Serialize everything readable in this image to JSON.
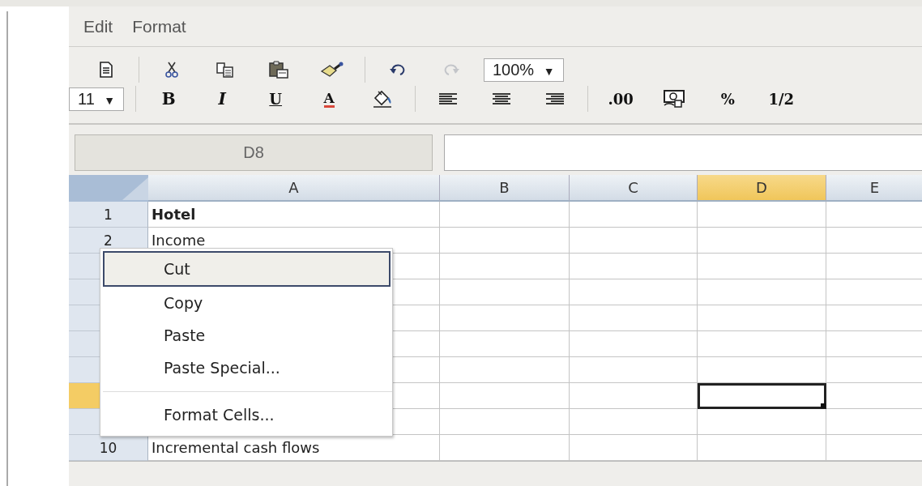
{
  "menu_bar": [
    {
      "label": "Edit"
    },
    {
      "label": "Format"
    }
  ],
  "toolbar_1": [
    {
      "kind": "new",
      "disabled": false
    },
    {
      "kind": "separator"
    },
    {
      "kind": "cut",
      "disabled": false
    },
    {
      "kind": "copy",
      "disabled": false
    },
    {
      "kind": "paste",
      "disabled": false
    },
    {
      "kind": "brush",
      "disabled": false
    },
    {
      "kind": "separator"
    },
    {
      "kind": "undo",
      "disabled": false
    },
    {
      "kind": "redo",
      "disabled": true
    },
    {
      "kind": "dropdown",
      "value": "100%",
      "caret": "▼"
    }
  ],
  "toolbar_2": [
    {
      "kind": "dropdown",
      "value": "11",
      "caret": "▼"
    },
    {
      "kind": "separator"
    },
    {
      "kind": "bold",
      "label": "B",
      "disabled": false
    },
    {
      "kind": "italic",
      "label": "I",
      "disabled": false
    },
    {
      "kind": "underline",
      "label": "U",
      "disabled": false
    },
    {
      "kind": "color",
      "label": "A",
      "disabled": false
    },
    {
      "kind": "fill",
      "disabled": false
    },
    {
      "kind": "separator"
    },
    {
      "kind": "align-left",
      "disabled": false
    },
    {
      "kind": "align-center",
      "disabled": false
    },
    {
      "kind": "align-right",
      "disabled": false
    },
    {
      "kind": "separator"
    },
    {
      "kind": "text",
      "label": ".00",
      "disabled": false
    },
    {
      "kind": "currency",
      "disabled": false
    },
    {
      "kind": "text",
      "label": "%",
      "disabled": false
    },
    {
      "kind": "fraction",
      "label": "1/2",
      "disabled": false
    }
  ],
  "name_box": {
    "value": "D8"
  },
  "columns": [
    {
      "label": "A",
      "selected": false
    },
    {
      "label": "B",
      "selected": false
    },
    {
      "label": "C",
      "selected": false
    },
    {
      "label": "D",
      "selected": true
    },
    {
      "label": "E",
      "selected": false
    }
  ],
  "rows": [
    {
      "number": "1",
      "selected": false,
      "cells": [
        {
          "text": "Hotel",
          "bold": true,
          "active": false
        },
        {
          "active": false
        },
        {
          "active": false
        },
        {
          "active": false
        },
        {
          "active": false
        }
      ]
    },
    {
      "number": "2",
      "selected": false,
      "cells": [
        {
          "text": "Income",
          "bold": false,
          "active": false
        },
        {
          "active": false
        },
        {
          "active": false
        },
        {
          "active": false
        },
        {
          "active": false
        }
      ]
    },
    {
      "selected": false,
      "cells": [
        {
          "active": false
        },
        {
          "active": false
        },
        {
          "active": false
        },
        {
          "active": false
        },
        {
          "active": false
        }
      ]
    },
    {
      "selected": false,
      "cells": [
        {
          "active": false
        },
        {
          "active": false
        },
        {
          "active": false
        },
        {
          "active": false
        },
        {
          "active": false
        }
      ]
    },
    {
      "selected": false,
      "cells": [
        {
          "active": false
        },
        {
          "active": false
        },
        {
          "active": false
        },
        {
          "active": false
        },
        {
          "active": false
        }
      ]
    },
    {
      "selected": false,
      "cells": [
        {
          "active": false
        },
        {
          "active": false
        },
        {
          "active": false
        },
        {
          "active": false
        },
        {
          "active": false
        }
      ]
    },
    {
      "selected": false,
      "cells": [
        {
          "active": false
        },
        {
          "active": false
        },
        {
          "active": false
        },
        {
          "active": false
        },
        {
          "active": false
        }
      ]
    },
    {
      "selected": true,
      "cells": [
        {
          "active": false
        },
        {
          "active": false
        },
        {
          "active": false
        },
        {
          "active": true
        },
        {
          "active": false
        }
      ]
    },
    {
      "selected": false,
      "cells": [
        {
          "active": false
        },
        {
          "active": false
        },
        {
          "active": false
        },
        {
          "active": false
        },
        {
          "active": false
        }
      ]
    },
    {
      "number": "10",
      "selected": false,
      "cells": [
        {
          "text": "Incremental cash flows",
          "bold": false,
          "active": false
        },
        {
          "active": false
        },
        {
          "active": false
        },
        {
          "active": false
        },
        {
          "active": false
        }
      ]
    }
  ],
  "context_menu": [
    {
      "kind": "item",
      "label": "Cut",
      "selected": true
    },
    {
      "kind": "item",
      "label": "Copy",
      "selected": false
    },
    {
      "kind": "item",
      "label": "Paste",
      "selected": false
    },
    {
      "kind": "item",
      "label": "Paste Special...",
      "selected": false
    },
    {
      "kind": "separator"
    },
    {
      "kind": "item",
      "label": "Format Cells...",
      "selected": false
    }
  ]
}
